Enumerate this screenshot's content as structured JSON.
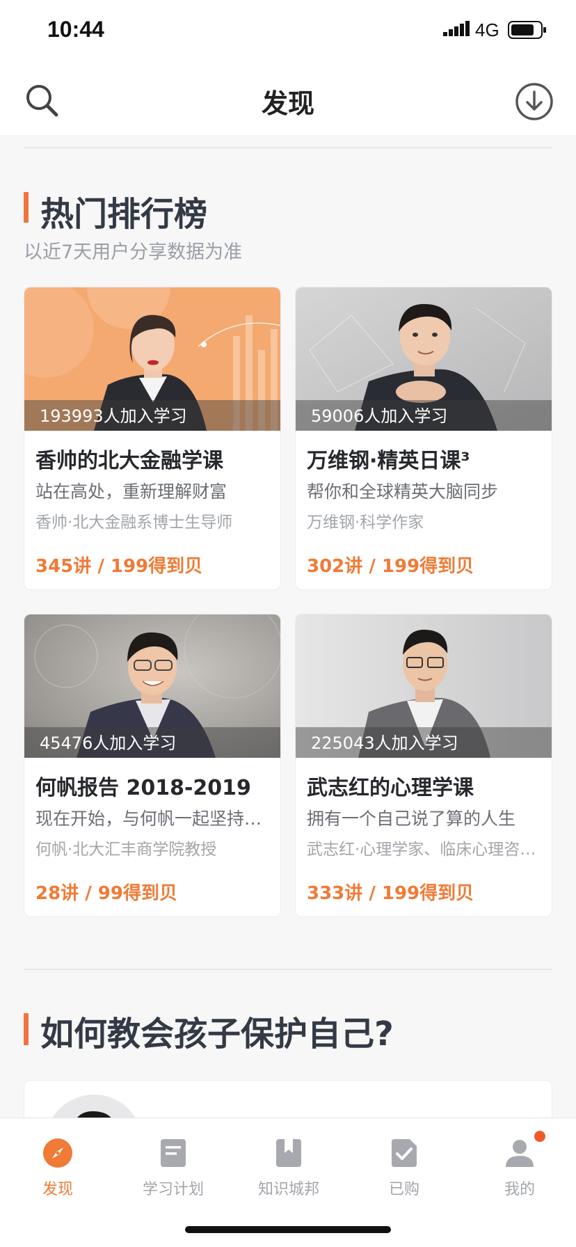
{
  "status": {
    "time": "10:44",
    "network": "4G"
  },
  "nav": {
    "title": "发现"
  },
  "ranking": {
    "title": "热门排行榜",
    "subtitle": "以近7天用户分享数据为准",
    "courses": [
      {
        "learners": "193993人加入学习",
        "title": "香帅的北大金融学课",
        "desc": "站在高处，重新理解财富",
        "author": "香帅·北大金融系博士生导师",
        "price": "345讲 / 199得到贝"
      },
      {
        "learners": "59006人加入学习",
        "title": "万维钢·精英日课³",
        "desc": "帮你和全球精英大脑同步",
        "author": "万维钢·科学作家",
        "price": "302讲 / 199得到贝"
      },
      {
        "learners": "45476人加入学习",
        "title": "何帆报告 2018-2019",
        "desc": "现在开始，与何帆一起坚持…",
        "author": "何帆·北大汇丰商学院教授",
        "price": "28讲 / 99得到贝"
      },
      {
        "learners": "225043人加入学习",
        "title": "武志红的心理学课",
        "desc": "拥有一个自己说了算的人生",
        "author": "武志红·心理学家、临床心理咨…",
        "price": "333讲 / 199得到贝"
      }
    ]
  },
  "section2": {
    "title": "如何教会孩子保护自己?"
  },
  "tabs": [
    {
      "label": "发现",
      "icon": "compass-icon",
      "active": true
    },
    {
      "label": "学习计划",
      "icon": "plan-icon",
      "active": false
    },
    {
      "label": "知识城邦",
      "icon": "bookmark-icon",
      "active": false
    },
    {
      "label": "已购",
      "icon": "purchased-icon",
      "active": false
    },
    {
      "label": "我的",
      "icon": "profile-icon",
      "active": false
    }
  ],
  "colors": {
    "accent": "#f07a36",
    "section_bar": "#f0753c",
    "notification": "#f05a28"
  }
}
